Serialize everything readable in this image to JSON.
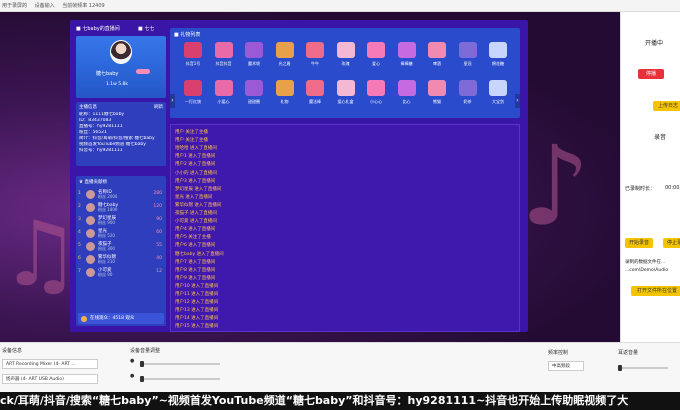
{
  "topbar": [
    "用于录屏的",
    "设备输入",
    "当前帧频率 12409"
  ],
  "window": {
    "title": "七baby的直播间",
    "tag": "七七"
  },
  "profile": {
    "name": "糖七baby",
    "stats": "1.1w   5.8k"
  },
  "info": {
    "title": "主播信息",
    "action": "刷新",
    "lines": [
      "昵称：1111糖七baby",
      "ID：83437083",
      "直播号：hy9281111",
      "粉丝：56521",
      "简介：抖音/耳萌/抖音/搜索 糖七baby",
      "视频首发YouTube频道 糖七baby",
      "抖音号：hy9281111"
    ]
  },
  "ranking": {
    "title": "直播贡献榜",
    "rows": [
      {
        "rank": "1",
        "name": "名称ID",
        "sub": "粉丝 2000",
        "points": "280"
      },
      {
        "rank": "2",
        "name": "糖七baby",
        "sub": "粉丝 1800",
        "points": "120"
      },
      {
        "rank": "3",
        "name": "梦幻星辰",
        "sub": "粉丝 900",
        "points": "90"
      },
      {
        "rank": "4",
        "name": "星光",
        "sub": "粉丝 520",
        "points": "60"
      },
      {
        "rank": "5",
        "name": "夜猫子",
        "sub": "粉丝 300",
        "points": "55"
      },
      {
        "rank": "6",
        "name": "繁华似锦",
        "sub": "粉丝 210",
        "points": "40"
      },
      {
        "rank": "7",
        "name": "小可爱",
        "sub": "粉丝 90",
        "points": "12"
      }
    ],
    "footer": "在线观众：4518 观众"
  },
  "gifts": {
    "title": "礼物列表",
    "row1": [
      "抖音1号",
      "抖音抖音",
      "魔术袋",
      "光之盾",
      "牛牛",
      "玫瑰",
      "爱心",
      "棒棒糖",
      "啤酒",
      "皇冠",
      "棉花糖"
    ],
    "row2": [
      "一打红旗",
      "小爱心",
      "甜甜圈",
      "礼物",
      "魔法棒",
      "爱心礼盒",
      "小心心",
      "比心",
      "熊猫",
      "奶茶",
      "大宝剑"
    ]
  },
  "chat": {
    "messages": [
      "用户 关注了主播",
      "用户 关注了主播",
      "哈哈哈 进入了直播间",
      "用户1 进入了直播间",
      "用户2 进入了直播间",
      "小小的 进入了直播间",
      "用户3 进入了直播间",
      "梦幻星辰 进入了直播间",
      "星光 进入了直播间",
      "繁华似锦 进入了直播间",
      "夜猫子 进入了直播间",
      "小可爱 进入了直播间",
      "用户4 进入了直播间",
      "用户5 关注了主播",
      "用户6 进入了直播间",
      "糖七baby 进入了直播间",
      "用户7 进入了直播间",
      "用户8 进入了直播间",
      "用户9 进入了直播间",
      "用户10 进入了直播间",
      "用户11 进入了直播间",
      "用户12 进入了直播间",
      "用户13 进入了直播间",
      "用户14 进入了直播间",
      "用户15 进入了直播间"
    ]
  },
  "sidebar": {
    "stream_title": "开播中",
    "stop_btn": "停播",
    "upload_btn": "上传日志",
    "record_title": "录音",
    "record_time_label": "已录制时长：",
    "record_time": "00:00",
    "start_btn": "开始录音",
    "stop_rec_btn": "停止录音",
    "path_label": "录制的数据文件在...",
    "path": "...com\\Demo\\Audio",
    "open_btn": "打开文件所在位置"
  },
  "bottom": {
    "device_label": "设备信息",
    "device1": "ART Recording Mixer (4- ART ...",
    "device2": "扬声器 (4- ART USB Audio)",
    "volume_label": "设备音量调整",
    "monitor_label": "频率控制",
    "monitor_value": "中高频段",
    "ear_label": "耳返音量"
  },
  "banner": "ck/耳萌/抖音/搜索“糖七baby”~视频首发YouTube频道“糖七baby”和抖音号：hy9281111~抖音也开始上传助眠视频了大",
  "colors": {
    "panel": "#3a16a8",
    "chat_text": "#ffc24a",
    "stop": "#e8323a",
    "gold": "#f5c400"
  }
}
